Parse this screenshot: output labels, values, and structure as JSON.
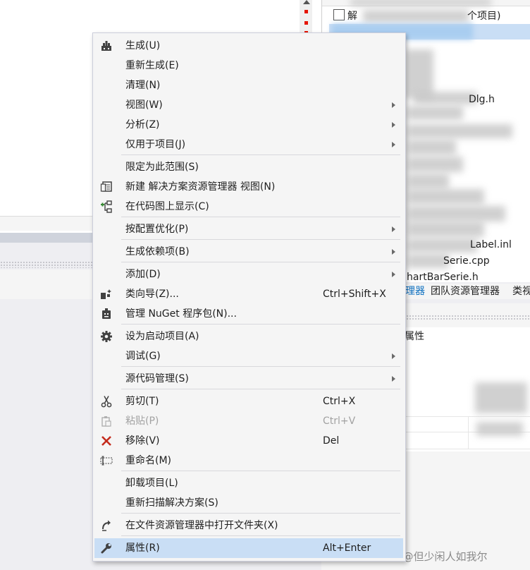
{
  "solution_explorer": {
    "solution_label_prefix": "解",
    "solution_label_suffix": "个项目)",
    "visible_fragments": [
      "Dlg.h",
      "Label.inl",
      "Serie.cpp",
      "hartBarSerie.h"
    ],
    "tabs": [
      "理器",
      "团队资源管理器",
      "类视"
    ]
  },
  "properties_panel": {
    "title": "属性"
  },
  "watermark": "CSDN @但少闲人如我尔",
  "context_menu": {
    "items": [
      {
        "label": "生成(U)",
        "shortcut": "",
        "icon": "build-icon",
        "submenu": false,
        "disabled": false
      },
      {
        "label": "重新生成(E)",
        "shortcut": "",
        "icon": "",
        "submenu": false,
        "disabled": false
      },
      {
        "label": "清理(N)",
        "shortcut": "",
        "icon": "",
        "submenu": false,
        "disabled": false
      },
      {
        "label": "视图(W)",
        "shortcut": "",
        "icon": "",
        "submenu": true,
        "disabled": false
      },
      {
        "label": "分析(Z)",
        "shortcut": "",
        "icon": "",
        "submenu": true,
        "disabled": false
      },
      {
        "label": "仅用于项目(J)",
        "shortcut": "",
        "icon": "",
        "submenu": true,
        "disabled": false
      },
      {
        "label": "限定为此范围(S)",
        "shortcut": "",
        "icon": "",
        "submenu": false,
        "disabled": false
      },
      {
        "label": "新建 解决方案资源管理器 视图(N)",
        "shortcut": "",
        "icon": "new-view-icon",
        "submenu": false,
        "disabled": false
      },
      {
        "label": "在代码图上显示(C)",
        "shortcut": "",
        "icon": "code-map-icon",
        "submenu": false,
        "disabled": false
      },
      {
        "label": "按配置优化(P)",
        "shortcut": "",
        "icon": "",
        "submenu": true,
        "disabled": false
      },
      {
        "label": "生成依赖项(B)",
        "shortcut": "",
        "icon": "",
        "submenu": true,
        "disabled": false
      },
      {
        "label": "添加(D)",
        "shortcut": "",
        "icon": "",
        "submenu": true,
        "disabled": false
      },
      {
        "label": "类向导(Z)...",
        "shortcut": "Ctrl+Shift+X",
        "icon": "class-wizard-icon",
        "submenu": false,
        "disabled": false
      },
      {
        "label": "管理 NuGet 程序包(N)...",
        "shortcut": "",
        "icon": "nuget-icon",
        "submenu": false,
        "disabled": false
      },
      {
        "label": "设为启动项目(A)",
        "shortcut": "",
        "icon": "gear-icon",
        "submenu": false,
        "disabled": false
      },
      {
        "label": "调试(G)",
        "shortcut": "",
        "icon": "",
        "submenu": true,
        "disabled": false
      },
      {
        "label": "源代码管理(S)",
        "shortcut": "",
        "icon": "",
        "submenu": true,
        "disabled": false
      },
      {
        "label": "剪切(T)",
        "shortcut": "Ctrl+X",
        "icon": "scissors-icon",
        "submenu": false,
        "disabled": false
      },
      {
        "label": "粘贴(P)",
        "shortcut": "Ctrl+V",
        "icon": "paste-icon",
        "submenu": false,
        "disabled": true
      },
      {
        "label": "移除(V)",
        "shortcut": "Del",
        "icon": "remove-icon",
        "submenu": false,
        "disabled": false
      },
      {
        "label": "重命名(M)",
        "shortcut": "",
        "icon": "rename-icon",
        "submenu": false,
        "disabled": false
      },
      {
        "label": "卸载项目(L)",
        "shortcut": "",
        "icon": "",
        "submenu": false,
        "disabled": false
      },
      {
        "label": "重新扫描解决方案(S)",
        "shortcut": "",
        "icon": "",
        "submenu": false,
        "disabled": false
      },
      {
        "label": "在文件资源管理器中打开文件夹(X)",
        "shortcut": "",
        "icon": "open-folder-icon",
        "submenu": false,
        "disabled": false
      },
      {
        "label": "属性(R)",
        "shortcut": "Alt+Enter",
        "icon": "wrench-icon",
        "submenu": false,
        "disabled": false,
        "highlighted": true
      }
    ]
  }
}
